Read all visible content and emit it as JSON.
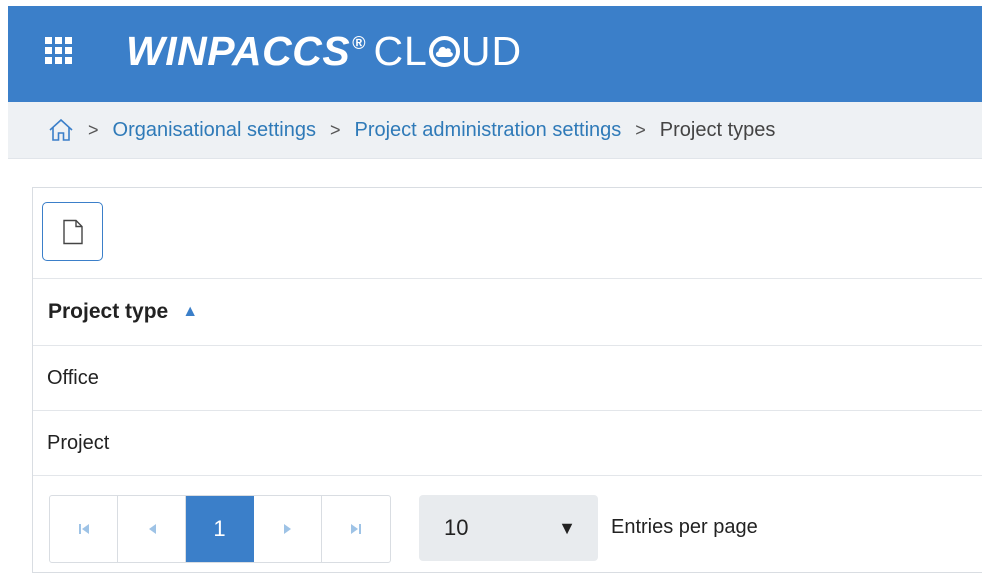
{
  "header": {
    "brand_main": "WINPACCS",
    "brand_reg": "®",
    "brand_cloud_pre": "CL",
    "brand_cloud_post": "UD",
    "background": "#3b7fc9",
    "menu_icon": "app-grid-icon"
  },
  "breadcrumb": {
    "home_icon": "home-icon",
    "separator": ">",
    "items": [
      {
        "label": "Organisational settings",
        "link": true
      },
      {
        "label": "Project administration settings",
        "link": true
      },
      {
        "label": "Project types",
        "link": false
      }
    ]
  },
  "toolbar": {
    "new_button_icon": "new-document-icon"
  },
  "table": {
    "column_header": "Project type",
    "sort_indicator": "▲",
    "rows": [
      "Office",
      "Project"
    ]
  },
  "pagination": {
    "first": "⏮",
    "prev": "◀",
    "current_page": "1",
    "next": "▶",
    "last": "⏭",
    "page_size": "10",
    "page_size_caret": "▼",
    "entries_label": "Entries per page"
  }
}
